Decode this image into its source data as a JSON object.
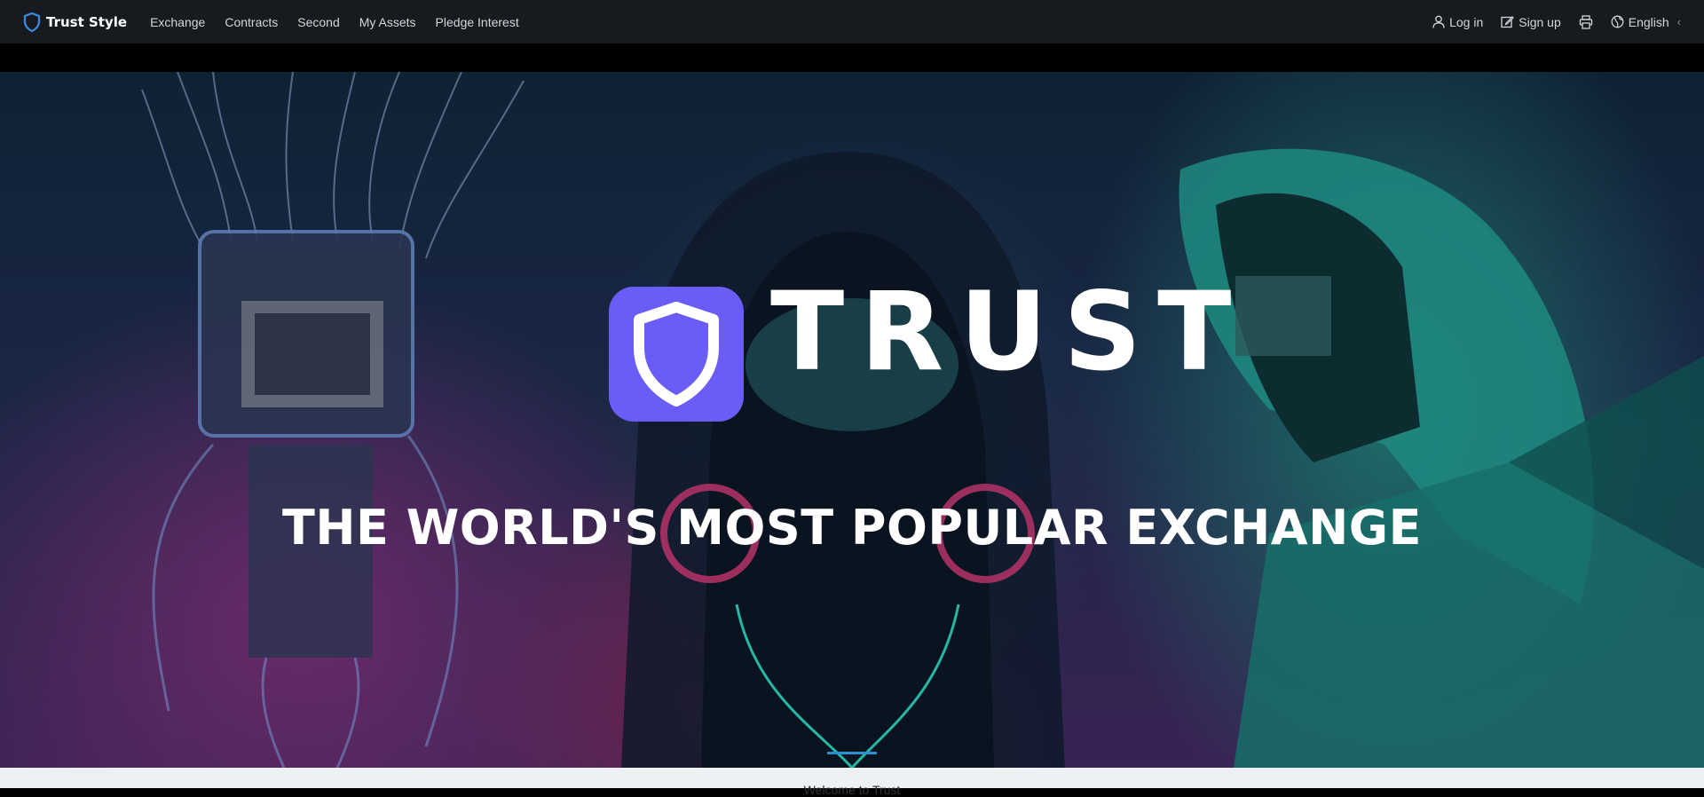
{
  "brand": {
    "name": "Trust Style",
    "icon": "shield-icon"
  },
  "nav": {
    "links": [
      "Exchange",
      "Contracts",
      "Second",
      "My Assets",
      "Pledge Interest"
    ],
    "login": "Log in",
    "signup": "Sign up",
    "language": "English",
    "chevron": "‹"
  },
  "hero": {
    "brand_text": "TRUST",
    "tagline": "THE WORLD'S MOST POPULAR EXCHANGE",
    "logo_color": "#6a5cf6"
  },
  "bottom": {
    "welcome": "Welcome to Trust"
  },
  "colors": {
    "navbar": "#171b20",
    "accent": "#2a8fd6"
  }
}
